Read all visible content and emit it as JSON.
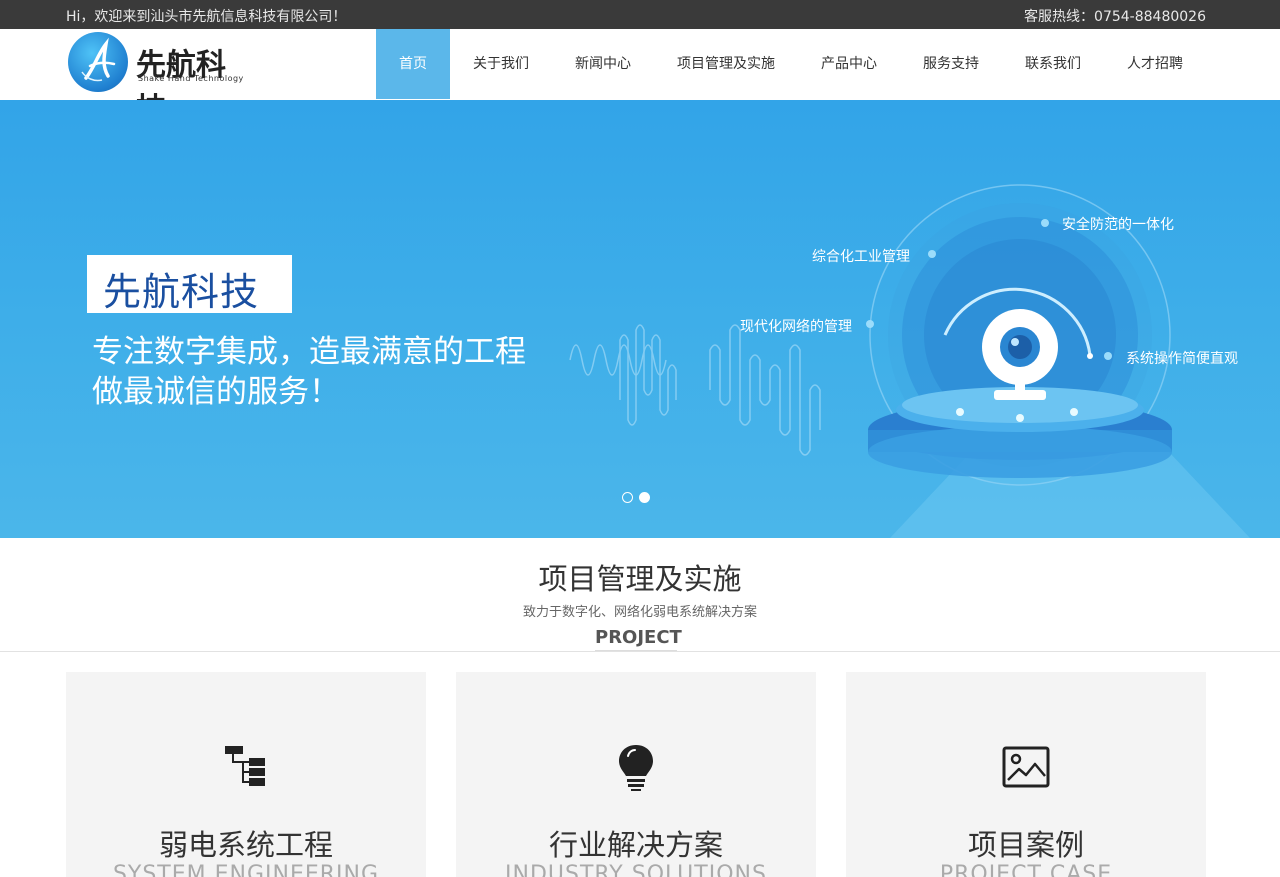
{
  "topbar": {
    "welcome": "Hi，欢迎来到汕头市先航信息科技有限公司！",
    "hotline": "客服热线：0754-88480026"
  },
  "logo": {
    "cn": "先航科技",
    "en": "Shake Hand Technology"
  },
  "nav": {
    "items": [
      {
        "label": "首页",
        "active": true
      },
      {
        "label": "关于我们"
      },
      {
        "label": "新闻中心"
      },
      {
        "label": "项目管理及实施"
      },
      {
        "label": "产品中心"
      },
      {
        "label": "服务支持"
      },
      {
        "label": "联系我们"
      },
      {
        "label": "人才招聘"
      }
    ]
  },
  "banner": {
    "title": "先航科技",
    "line1": "专注数字集成，造最满意的工程",
    "line2": "做最诚信的服务！",
    "features": [
      "安全防范的一体化",
      "综合化工业管理",
      "现代化网络的管理",
      "系统操作简便直观"
    ],
    "active_slide": 2,
    "slide_count": 2
  },
  "section": {
    "title": "项目管理及实施",
    "subtitle": "致力于数字化、网络化弱电系统解决方案",
    "en": "PROJECT"
  },
  "cards": [
    {
      "title": "弱电系统工程",
      "en": "SYSTEM ENGINEERING",
      "icon": "sitemap-icon"
    },
    {
      "title": "行业解决方案",
      "en": "INDUSTRY SOLUTIONS",
      "icon": "lightbulb-icon"
    },
    {
      "title": "项目案例",
      "en": "PROJECT CASE",
      "icon": "picture-icon"
    }
  ],
  "colors": {
    "topbar": "#3a3a3a",
    "nav_active": "#5bb7ea",
    "banner": "#3eaee9",
    "brand_blue": "#1a4fa0",
    "card_bg": "#f4f4f4"
  }
}
